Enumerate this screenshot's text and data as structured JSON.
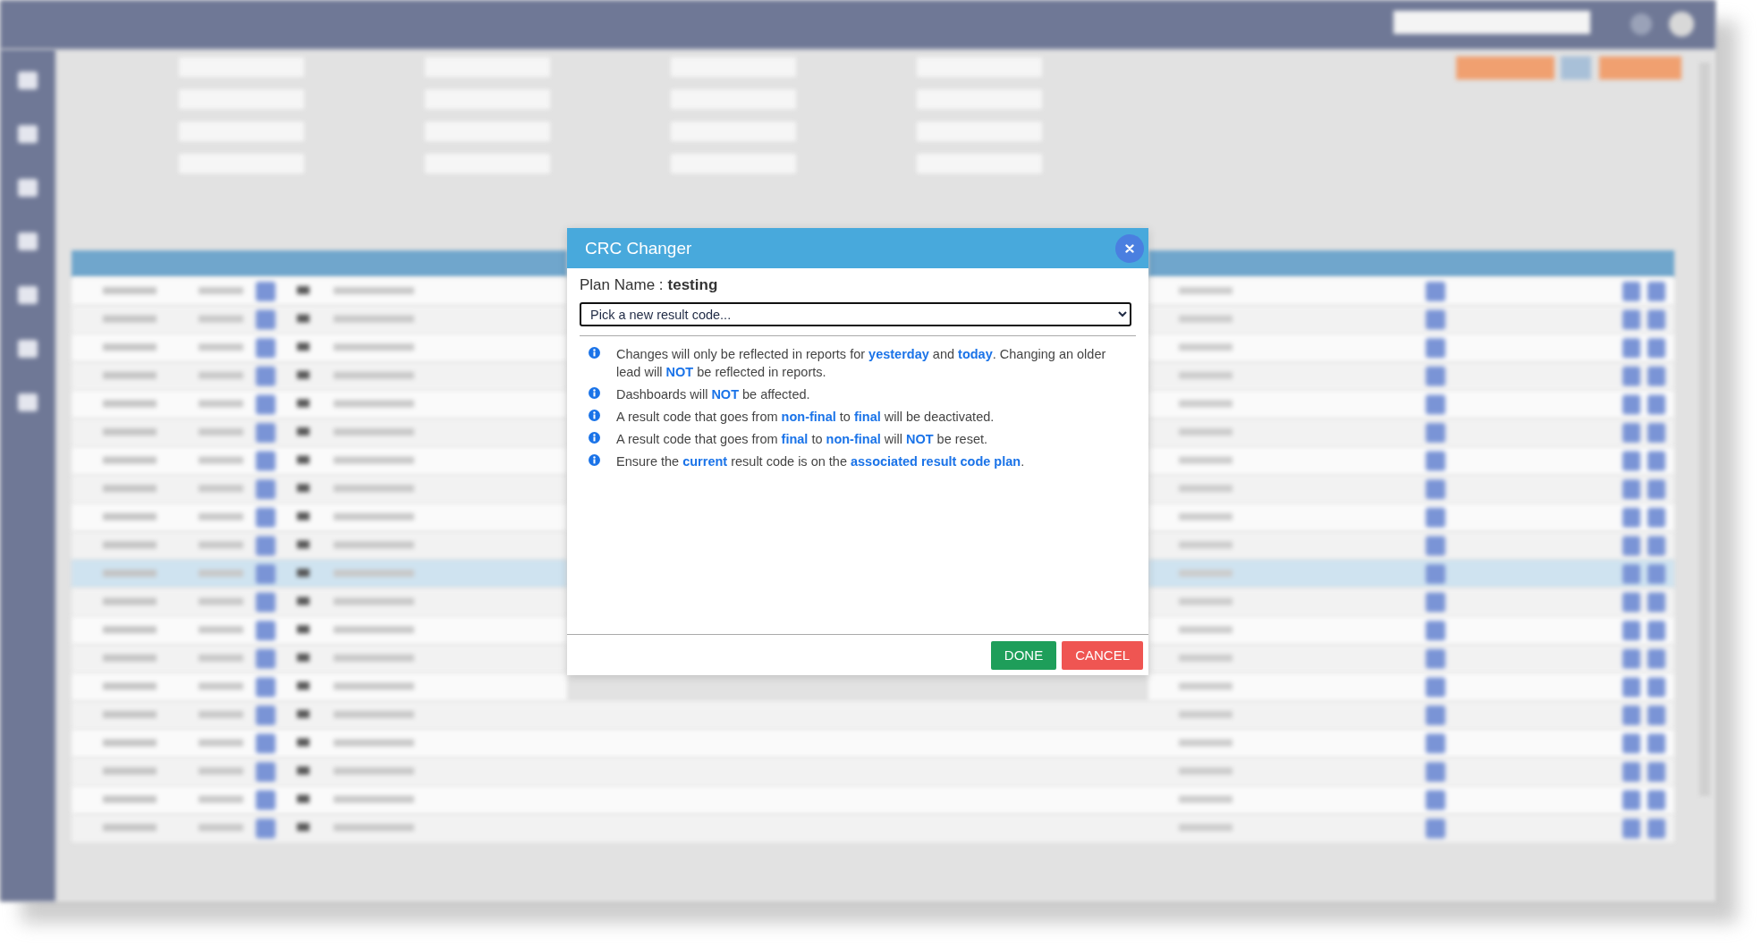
{
  "dialog": {
    "title": "CRC Changer",
    "plan_name": {
      "label": "Plan Name :",
      "value": "testing"
    },
    "result_code_select": {
      "placeholder": "Pick a new result code..."
    },
    "notes": [
      {
        "text": "Changes will only be reflected in reports for **yesterday** and **today**. Changing an older lead will **NOT** be reflected in reports."
      },
      {
        "text": "Dashboards will **NOT** be affected."
      },
      {
        "text": "A result code that goes from **non-final** to **final** will be deactivated."
      },
      {
        "text": "A result code that goes from **final** to **non-final** will **NOT** be reset."
      },
      {
        "text": "Ensure the **current** result code is on the **associated result code plan**."
      }
    ],
    "buttons": [
      {
        "label": "DONE",
        "kind": "confirm"
      },
      {
        "label": "CANCEL",
        "kind": "cancel"
      }
    ]
  }
}
